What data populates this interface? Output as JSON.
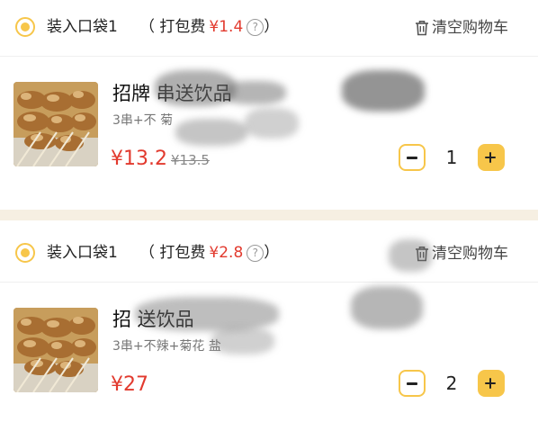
{
  "bags": [
    {
      "name": "装入口袋1",
      "pack_fee_label": "（ 打包费",
      "pack_fee_price": "¥1.4",
      "pack_fee_close": "）",
      "help_icon": "?",
      "clear_label": "清空购物车",
      "item": {
        "title": "招牌 串送饮品",
        "spec": "3串+不 菊",
        "price": "¥13.2",
        "original_price": "¥13.5",
        "quantity": "1"
      }
    },
    {
      "name": "装入口袋1",
      "pack_fee_label": "（ 打包费",
      "pack_fee_price": "¥2.8",
      "pack_fee_close": "）",
      "help_icon": "?",
      "clear_label": "清空购物车",
      "item": {
        "title": "招 送饮品",
        "spec": "3串+不辣+菊花 盐",
        "price": "¥27",
        "original_price": "",
        "quantity": "2"
      }
    }
  ],
  "icons": {
    "radio": "radio-selected-icon",
    "help": "help-icon",
    "trash": "trash-icon",
    "minus": "minus-icon",
    "plus": "plus-icon"
  },
  "colors": {
    "accent": "#f7c64a",
    "price": "#e23a2e",
    "separator": "#f6efe2"
  }
}
